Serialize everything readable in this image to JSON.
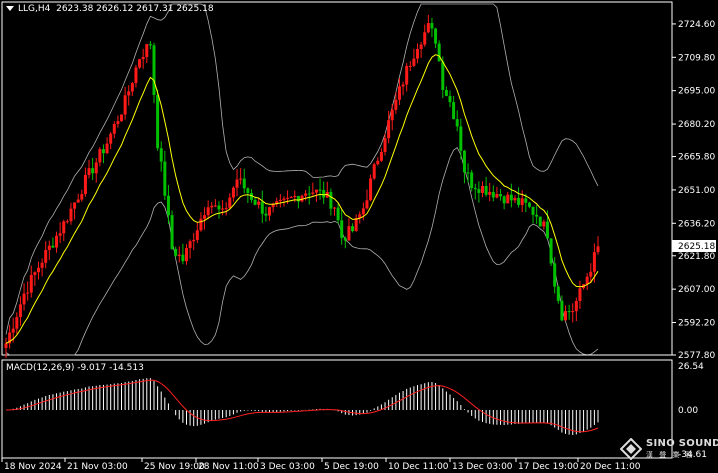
{
  "header": {
    "symbol": "LLG,H4",
    "ohlc": "2623.38 2626.12 2617.31 2625.18"
  },
  "macd": {
    "label": "MACD(12,26,9) -9.017 -14.513",
    "axis_top": "26.54",
    "axis_zero": "0.00",
    "axis_bottom": "-34.61"
  },
  "price_axis": {
    "ticks": [
      "2724.60",
      "2709.80",
      "2695.00",
      "2680.20",
      "2665.80",
      "2651.00",
      "2636.20",
      "2621.80",
      "2607.00",
      "2592.20",
      "2577.80"
    ],
    "current": "2625.18"
  },
  "time_axis": {
    "labels": [
      "18 Nov 2024",
      "21 Nov 03:00",
      "25 Nov 19:00",
      "28 Nov 11:00",
      "3 Dec 03:00",
      "5 Dec 19:00",
      "10 Dec 11:00",
      "13 Dec 03:00",
      "17 Dec 19:00",
      "20 Dec 11:00"
    ]
  },
  "logo": {
    "name": "SINO SOUND",
    "sub": "漢 聲 業 務"
  },
  "colors": {
    "background": "#000000",
    "bull": "#ff1a1a",
    "bear": "#00c000",
    "ma": "#ffff00",
    "bands": "#b0b0b0",
    "signal": "#ff2020",
    "histogram": "#ffffff",
    "grid_frame": "#ffffff"
  },
  "chart_data": {
    "type": "candlestick",
    "ylim": [
      2577.8,
      2729
    ],
    "anchor_price_path": [
      [
        0,
        2583
      ],
      [
        5,
        2605
      ],
      [
        10,
        2620
      ],
      [
        16,
        2636
      ],
      [
        22,
        2655
      ],
      [
        28,
        2672
      ],
      [
        33,
        2690
      ],
      [
        37,
        2710
      ],
      [
        40,
        2716
      ],
      [
        42,
        2672
      ],
      [
        44,
        2650
      ],
      [
        46,
        2625
      ],
      [
        49,
        2620
      ],
      [
        52,
        2631
      ],
      [
        56,
        2646
      ],
      [
        60,
        2640
      ],
      [
        64,
        2656
      ],
      [
        66,
        2652
      ],
      [
        69,
        2646
      ],
      [
        72,
        2641
      ],
      [
        76,
        2644
      ],
      [
        80,
        2648
      ],
      [
        84,
        2651
      ],
      [
        88,
        2649
      ],
      [
        91,
        2644
      ],
      [
        93,
        2630
      ],
      [
        96,
        2633
      ],
      [
        99,
        2643
      ],
      [
        102,
        2660
      ],
      [
        105,
        2676
      ],
      [
        108,
        2690
      ],
      [
        111,
        2704
      ],
      [
        114,
        2716
      ],
      [
        117,
        2723
      ],
      [
        119,
        2718
      ],
      [
        121,
        2698
      ],
      [
        123,
        2690
      ],
      [
        125,
        2680
      ],
      [
        127,
        2660
      ],
      [
        129,
        2654
      ],
      [
        132,
        2652
      ],
      [
        135,
        2650
      ],
      [
        138,
        2648
      ],
      [
        141,
        2646
      ],
      [
        144,
        2644
      ],
      [
        147,
        2640
      ],
      [
        150,
        2632
      ],
      [
        152,
        2610
      ],
      [
        154,
        2596
      ],
      [
        157,
        2598
      ],
      [
        159,
        2605
      ],
      [
        161,
        2613
      ],
      [
        164,
        2625
      ]
    ],
    "macd_note": "histogram bars and signal line"
  }
}
